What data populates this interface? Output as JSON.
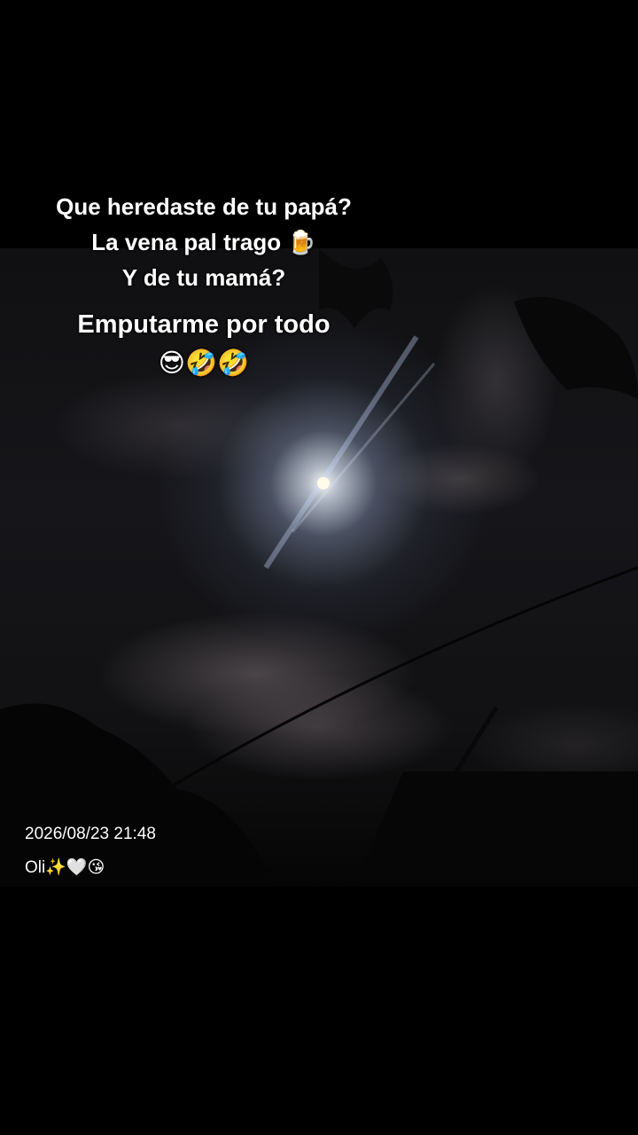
{
  "caption": {
    "question_dad": "Que heredaste de tu papá?",
    "answer_dad": "La vena pal trago 🍺",
    "question_mom": "Y de tu mamá?",
    "answer_mom": "Emputarme por todo",
    "emojis": "😎🤣🤣"
  },
  "overlay": {
    "timestamp": "2026/08/23 21:48",
    "username": "Oli✨🤍😘"
  }
}
